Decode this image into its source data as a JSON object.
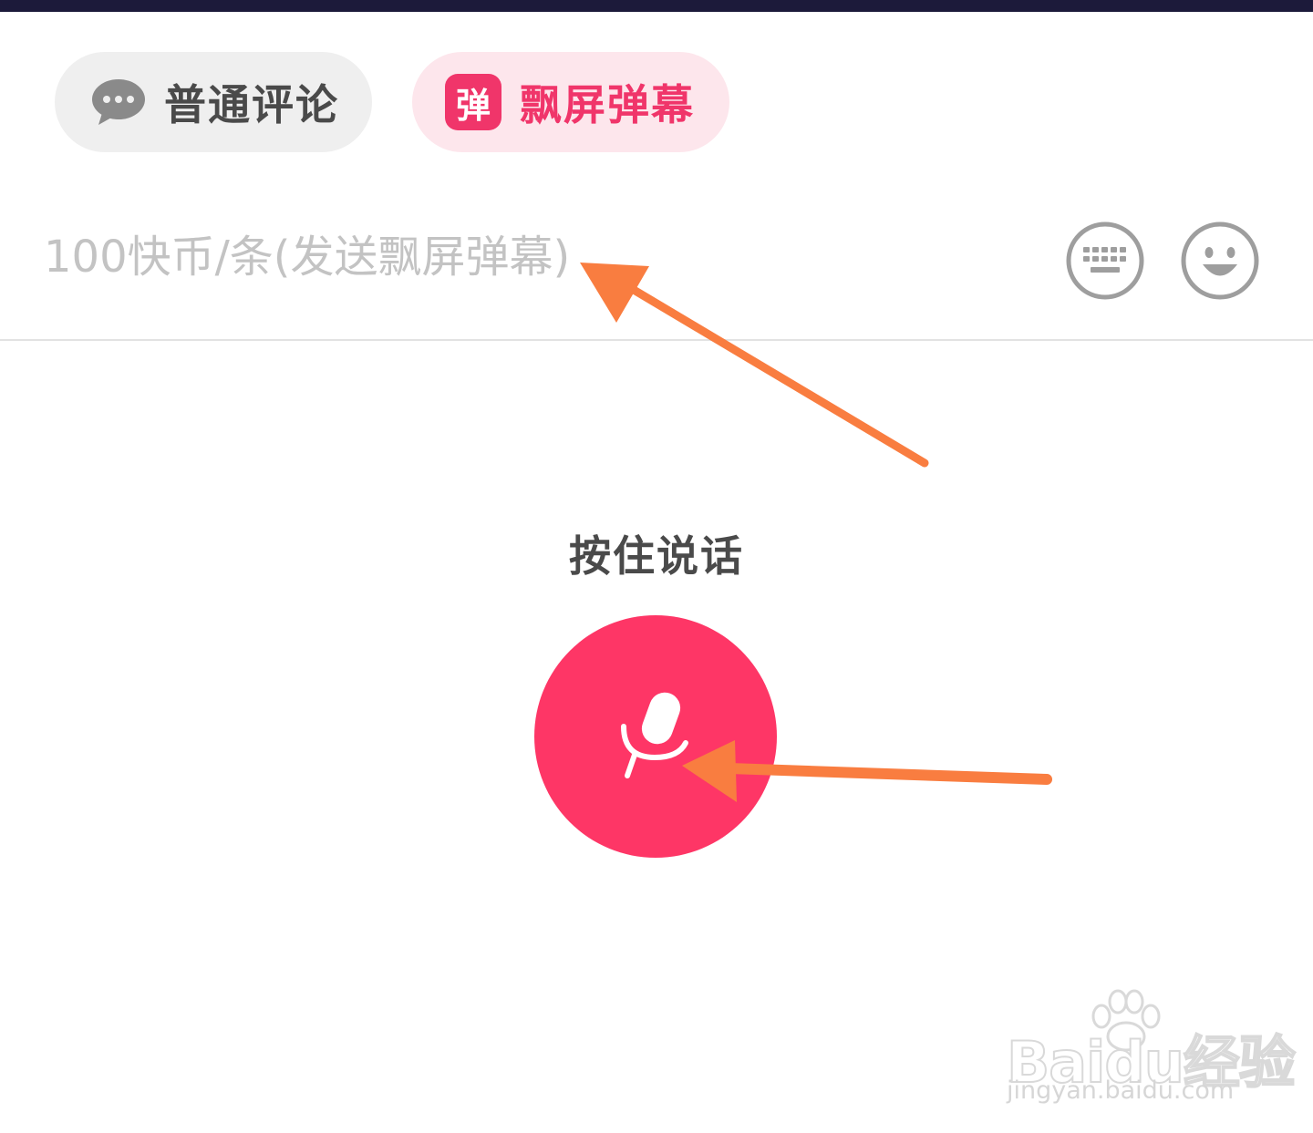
{
  "tabs": {
    "normal": {
      "label": "普通评论",
      "icon": "chat-bubble-icon"
    },
    "danmaku": {
      "label": "飘屏弹幕",
      "badge": "弹",
      "icon": "danmaku-badge-icon"
    }
  },
  "input": {
    "placeholder": "100快币/条(发送飘屏弹幕)",
    "value": ""
  },
  "icons": {
    "keyboard": "keyboard-icon",
    "emoji": "emoji-icon",
    "microphone": "microphone-icon"
  },
  "voice": {
    "hold_label": "按住说话"
  },
  "annotations": {
    "arrow_color": "#f97d40",
    "arrows": [
      "arrow-to-input",
      "arrow-to-mic"
    ]
  },
  "watermark": {
    "brand_text": "Baidu经验",
    "url": "jingyan.baidu.com"
  },
  "colors": {
    "accent": "#fe3666",
    "tab_active_bg": "#fde6ec",
    "tab_inactive_bg": "#efefef",
    "top_bar": "#1c1a3a"
  }
}
